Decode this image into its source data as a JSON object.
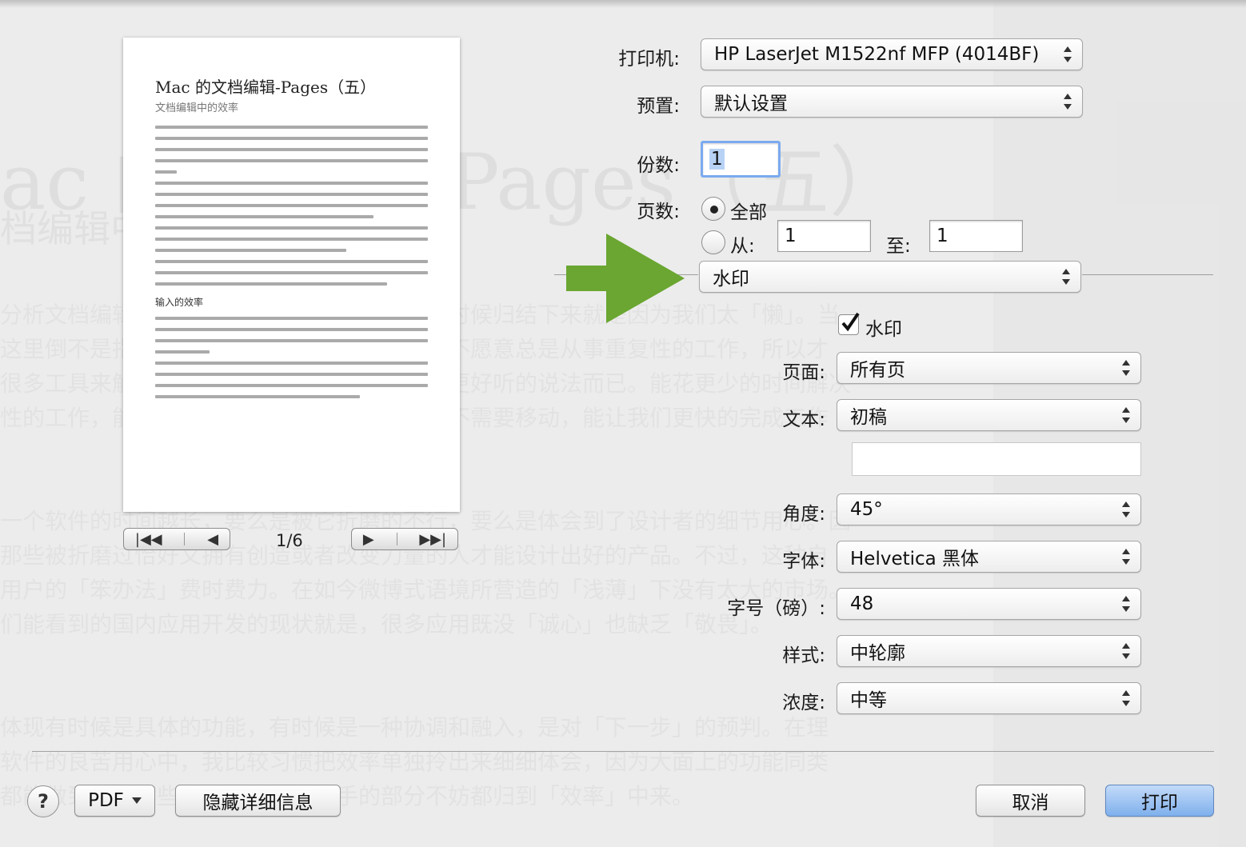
{
  "background_document": {
    "title_fragment_left": "ac 的",
    "title_fragment_right": "Pages（五）",
    "subtitle_fragment": "档编辑中",
    "lines": [
      "分析文档编辑软件为什么要那么些功能。很多时候归结下来就是因为我们太「懒」。当",
      "这里倒不是指它的贬义，实际上正是因为我们不愿意总是从事重复性的工作，所以才",
      "很多工具来解放我们自己，效率只是换了一个更好听的说法而已。能花更少的时间解决",
      "性的工作，能让鼠标指针移动的距离更短甚至不需要移动，能让我们更快的完成工作",
      "一个软件的时间越长，要么是被它折磨的不行，要么是体会到了设计者的细节用心。因",
      "那些被折磨过恰好又拥有创造或者改变力量的人才能设计出好的产品。不过，这种自",
      "用户的「笨办法」费时费力。在如今微博式语境所营造的「浅薄」下没有太大的市场。",
      "们能看到的国内应用开发的现状就是，很多应用既没「诚心」也缺乏「敬畏」。",
      "体现有时候是具体的功能，有时候是一种协调和融入，是对「下一步」的预判。在理",
      "软件的良苦用心中，我比较习惯把效率单独拎出来细细体会，因为大面上的功能同类",
      "都能做到，而那些让人用起来很顺手的部分不妨都归到「效率」中来。"
    ]
  },
  "preview": {
    "title": "Mac 的文档编辑-Pages（五）",
    "subtitle": "文档编辑中的效率",
    "section_heading": "输入的效率",
    "page_indicator": "1/6"
  },
  "printer": {
    "label": "打印机:",
    "value": "HP LaserJet M1522nf MFP (4014BF)"
  },
  "presets": {
    "label": "预置:",
    "value": "默认设置"
  },
  "copies": {
    "label": "份数:",
    "value": "1"
  },
  "pages": {
    "label": "页数:",
    "all_label": "全部",
    "from_label": "从:",
    "from_value": "1",
    "to_label": "至:",
    "to_value": "1"
  },
  "section_select": {
    "value": "水印"
  },
  "watermark": {
    "checkbox_label": "水印",
    "checked": true,
    "page_label": "页面:",
    "page_value": "所有页",
    "text_label": "文本:",
    "text_value": "初稿",
    "custom_text": "",
    "angle_label": "角度:",
    "angle_value": "45°",
    "font_label": "字体:",
    "font_value": "Helvetica 黑体",
    "size_label": "字号（磅）:",
    "size_value": "48",
    "style_label": "样式:",
    "style_value": "中轮廓",
    "density_label": "浓度:",
    "density_value": "中等"
  },
  "footer": {
    "help_label": "?",
    "pdf_label": "PDF",
    "hide_details_label": "隐藏详细信息",
    "cancel_label": "取消",
    "print_label": "打印"
  },
  "colors": {
    "arrow": "#6aa631",
    "primary_button": "#7fb0ec",
    "focus_ring": "#7aaaf0"
  }
}
